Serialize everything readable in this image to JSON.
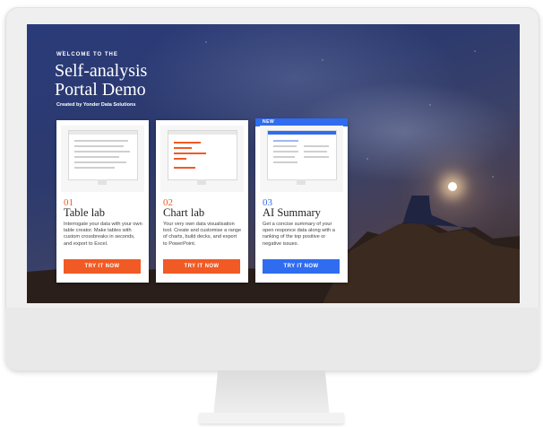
{
  "hero": {
    "welcome": "WELCOME TO THE",
    "title_line1": "Self-analysis",
    "title_line2": "Portal Demo",
    "created_by": "Created by Yonder Data Solutions"
  },
  "cards": [
    {
      "number": "01",
      "title": "Table lab",
      "description": "Interrogate your data with your own table creator. Make tables with custom crossbreaks in seconds, and export to Excel.",
      "button": "TRY IT NOW"
    },
    {
      "number": "02",
      "title": "Chart lab",
      "description": "Your very own data visualisation tool. Create and customise a range of charts, build decks, and export to PowerPoint.",
      "button": "TRY IT NOW"
    },
    {
      "badge": "NEW",
      "number": "03",
      "title": "AI Summary",
      "description": "Get a concise summary of your open responce data along with a ranking of the top positive or negative issues.",
      "button": "TRY IT NOW"
    }
  ],
  "colors": {
    "orange": "#f15a24",
    "blue": "#2f6cf0"
  }
}
